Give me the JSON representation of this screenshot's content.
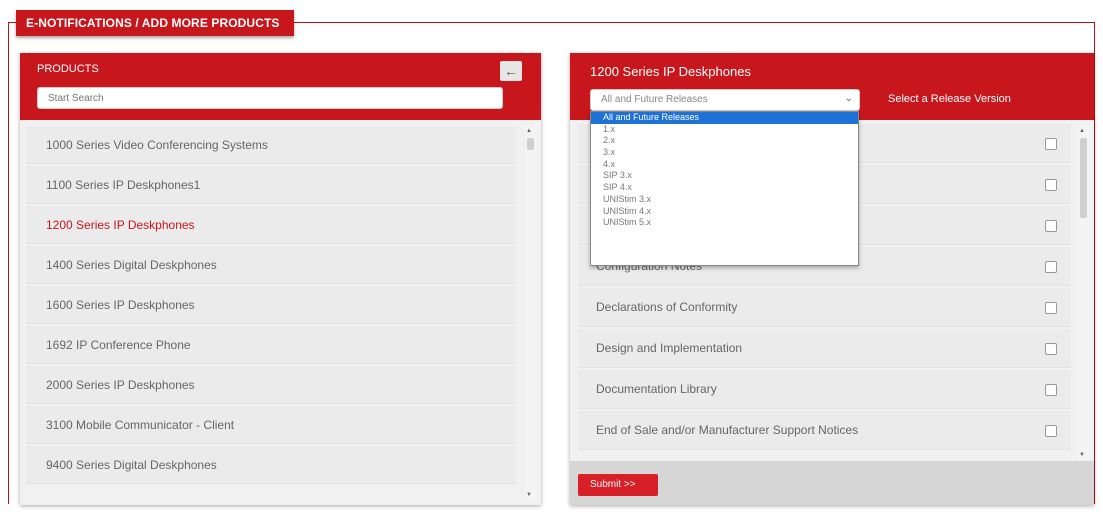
{
  "section": {
    "title": "E-NOTIFICATIONS / ADD MORE PRODUCTS"
  },
  "products_panel": {
    "title": "PRODUCTS",
    "back_icon": "arrow-left-icon",
    "search_placeholder": "Start Search",
    "items": [
      "1000 Series Video Conferencing Systems",
      "1100 Series IP Deskphones1",
      "1200 Series IP Deskphones",
      "1400 Series Digital Deskphones",
      "1600 Series IP Deskphones",
      "1692 IP Conference Phone",
      "2000 Series IP Deskphones",
      "3100 Mobile Communicator - Client",
      "9400 Series Digital Deskphones"
    ],
    "active_item": "1200 Series IP Deskphones"
  },
  "docs_panel": {
    "title": "1200 Series IP Deskphones",
    "release_select": {
      "selected": "All and Future Releases",
      "label": "Select a Release Version",
      "options": [
        "All and Future Releases",
        "1.x",
        "2.x",
        "3.x",
        "4.x",
        "SIP 3.x",
        "SIP 4.x",
        "UNIStim 3.x",
        "UNIStim 4.x",
        "UNIStim 5.x"
      ]
    },
    "rows": [
      "",
      "",
      "",
      "Configuration Notes",
      "Declarations of Conformity",
      "Design and Implementation",
      "Documentation Library",
      "End of Sale and/or Manufacturer Support Notices"
    ],
    "submit_label": "Submit >>"
  },
  "colors": {
    "accent": "#c8161d",
    "selected_option": "#1e72d6",
    "active_text": "#c8161d"
  }
}
